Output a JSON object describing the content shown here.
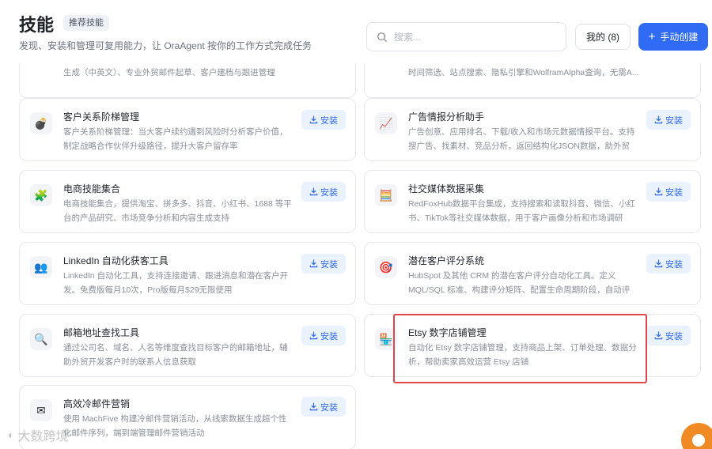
{
  "header": {
    "title": "技能",
    "badge": "推荐技能",
    "subtitle": "发现、安装和管理可复用能力，让 OraAgent 按你的工作方式完成任务",
    "search_placeholder": "搜索...",
    "my_button": "我的 (8)",
    "create_button": "手动创建"
  },
  "install_label": "安装",
  "partial_cards": [
    {
      "desc": "生成（中英文）、专业外贸邮件起草、客户建档与跟进管理"
    },
    {
      "desc": "时间筛选、站点搜索、隐私引擎和WolframAlpha查询，无需A..."
    }
  ],
  "cards": [
    {
      "title": "客户关系阶梯管理",
      "icon": "bomb-icon",
      "desc": "客户关系阶梯管理：当大客户续约遇到风险时分析客户价值，制定战略合作伙伴升级路径，提升大客户留存率"
    },
    {
      "title": "广告情报分析助手",
      "icon": "chart-icon",
      "desc": "广告创意、应用排名、下载/收入和市场元数据情报平台。支持搜广告、找素材、竞品分析，返回结构化JSON数据，助外贸企业..."
    },
    {
      "title": "电商技能集合",
      "icon": "puzzle-icon",
      "desc": "电商技能集合，提供淘宝、拼多多、抖音、小红书、1688 等平台的产品研究、市场竞争分析和内容生成支持"
    },
    {
      "title": "社交媒体数据采集",
      "icon": "abacus-icon",
      "desc": "RedFoxHub数据平台集成，支持搜索和读取抖音、微信、小红书、TikTok等社交媒体数据，用于客户画像分析和市场调研"
    },
    {
      "title": "LinkedIn 自动化获客工具",
      "icon": "users-icon",
      "desc": "LinkedIn 自动化工具，支持连接邀请、跟进消息和潜在客户开发。免费版每月10次，Pro版每月$29无限使用"
    },
    {
      "title": "潜在客户评分系统",
      "icon": "target-icon",
      "desc": "HubSpot 及其他 CRM 的潜在客户评分自动化工具。定义 MQL/SQL 标准、构建评分矩阵、配置生命周期阶段，自动评估..."
    },
    {
      "title": "邮箱地址查找工具",
      "icon": "magnifier-icon",
      "desc": "通过公司名、域名、人名等维度查找目标客户的邮箱地址，辅助外贸开发客户时的联系人信息获取"
    },
    {
      "title": "Etsy 数字店铺管理",
      "icon": "shop-icon",
      "desc": "自动化 Etsy 数字店铺管理，支持商品上架、订单处理、数据分析，帮助卖家高效运营 Etsy 店铺"
    },
    {
      "title": "高效冷邮件营销",
      "icon": "mail-icon",
      "desc": "使用 MachFive 构建冷邮件营销活动，从线索数据生成超个性化邮件序列，端到端管理邮件营销活动"
    }
  ],
  "watermark": "大数跨境",
  "colors": {
    "accent": "#2f6bf5",
    "highlight": "#e0454a",
    "chat": "#f08a24"
  }
}
